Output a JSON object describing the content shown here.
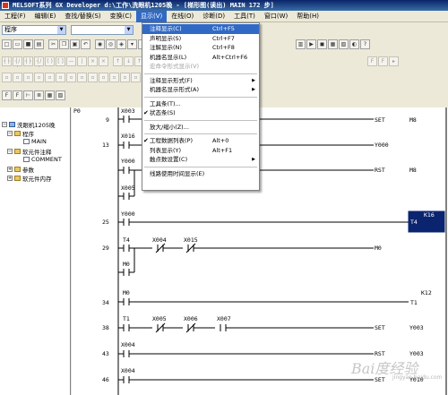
{
  "window": {
    "title": "MELSOFT系列 GX Developer d:\\工作\\洗眼机1205晚 - [梯形图(读出)       MAIN     172 步]"
  },
  "menubar": [
    "工程(F)",
    "编辑(E)",
    "查找/替换(S)",
    "变换(C)",
    "显示(V)",
    "在线(O)",
    "诊断(D)",
    "工具(T)",
    "窗口(W)",
    "帮助(H)"
  ],
  "toolbar": {
    "program_combo": "程序"
  },
  "view_menu": {
    "items": [
      {
        "label": "注释显示(C)",
        "shortcut": "Ctrl+F5",
        "highlight": true
      },
      {
        "label": "声明显示(S)",
        "shortcut": "Ctrl+F7"
      },
      {
        "label": "注解显示(N)",
        "shortcut": "Ctrl+F8"
      },
      {
        "label": "机器名显示(L)",
        "shortcut": "Alt+Ctrl+F6"
      },
      {
        "label": "宏命令形式显示(V)",
        "disabled": true
      },
      {
        "separator": true
      },
      {
        "label": "注释显示形式(F)",
        "submenu": true
      },
      {
        "label": "机器名显示形式(A)",
        "submenu": true
      },
      {
        "separator": true
      },
      {
        "label": "工具条(T)..."
      },
      {
        "label": "状态条(S)",
        "checked": true
      },
      {
        "separator": true
      },
      {
        "label": "放大/缩小(Z)..."
      },
      {
        "separator": true
      },
      {
        "label": "工程数据列表(P)",
        "shortcut": "Alt+0",
        "checked": true
      },
      {
        "label": "列表显示(Y)",
        "shortcut": "Alt+F1"
      },
      {
        "label": "触点数设置(C)",
        "submenu": true
      },
      {
        "separator": true
      },
      {
        "label": "线路使用时间显示(E)"
      }
    ]
  },
  "project_tree": {
    "root": "洗眼机1205晚",
    "nodes": [
      "程序",
      "MAIN",
      "软元件注释",
      "COMMENT",
      "参数",
      "软元件内存"
    ]
  },
  "ladder": {
    "start_label": "P0",
    "rungs": [
      {
        "step": "9",
        "contacts": [
          "X003"
        ],
        "coil": "SET",
        "coil_target": "M8"
      },
      {
        "step": "13",
        "contacts": [
          "X016",
          "Y000",
          "X005"
        ],
        "coil": "Y000"
      },
      {
        "step": "",
        "contacts": [],
        "coil": "RST",
        "coil_target": "M8"
      },
      {
        "step": "25",
        "contacts": [
          "Y000"
        ],
        "coil": "T4",
        "coil_target": "K16"
      },
      {
        "step": "29",
        "contacts": [
          "T4",
          "X004",
          "X015",
          "M0"
        ],
        "coil": "M0"
      },
      {
        "step": "34",
        "contacts": [
          "M0"
        ],
        "coil": "T1",
        "coil_target": "K12"
      },
      {
        "step": "38",
        "contacts": [
          "T1",
          "X005",
          "X006",
          "X007"
        ],
        "coil": "SET",
        "coil_target": "Y003"
      },
      {
        "step": "43",
        "contacts": [
          "X004"
        ],
        "coil": "RST",
        "coil_target": "Y003"
      },
      {
        "step": "46",
        "contacts": [
          "X004"
        ],
        "coil": "SET",
        "coil_target": "Y010"
      }
    ]
  },
  "watermark": {
    "text": "Bai度经验",
    "sub": "jingyan.baidu.com"
  }
}
